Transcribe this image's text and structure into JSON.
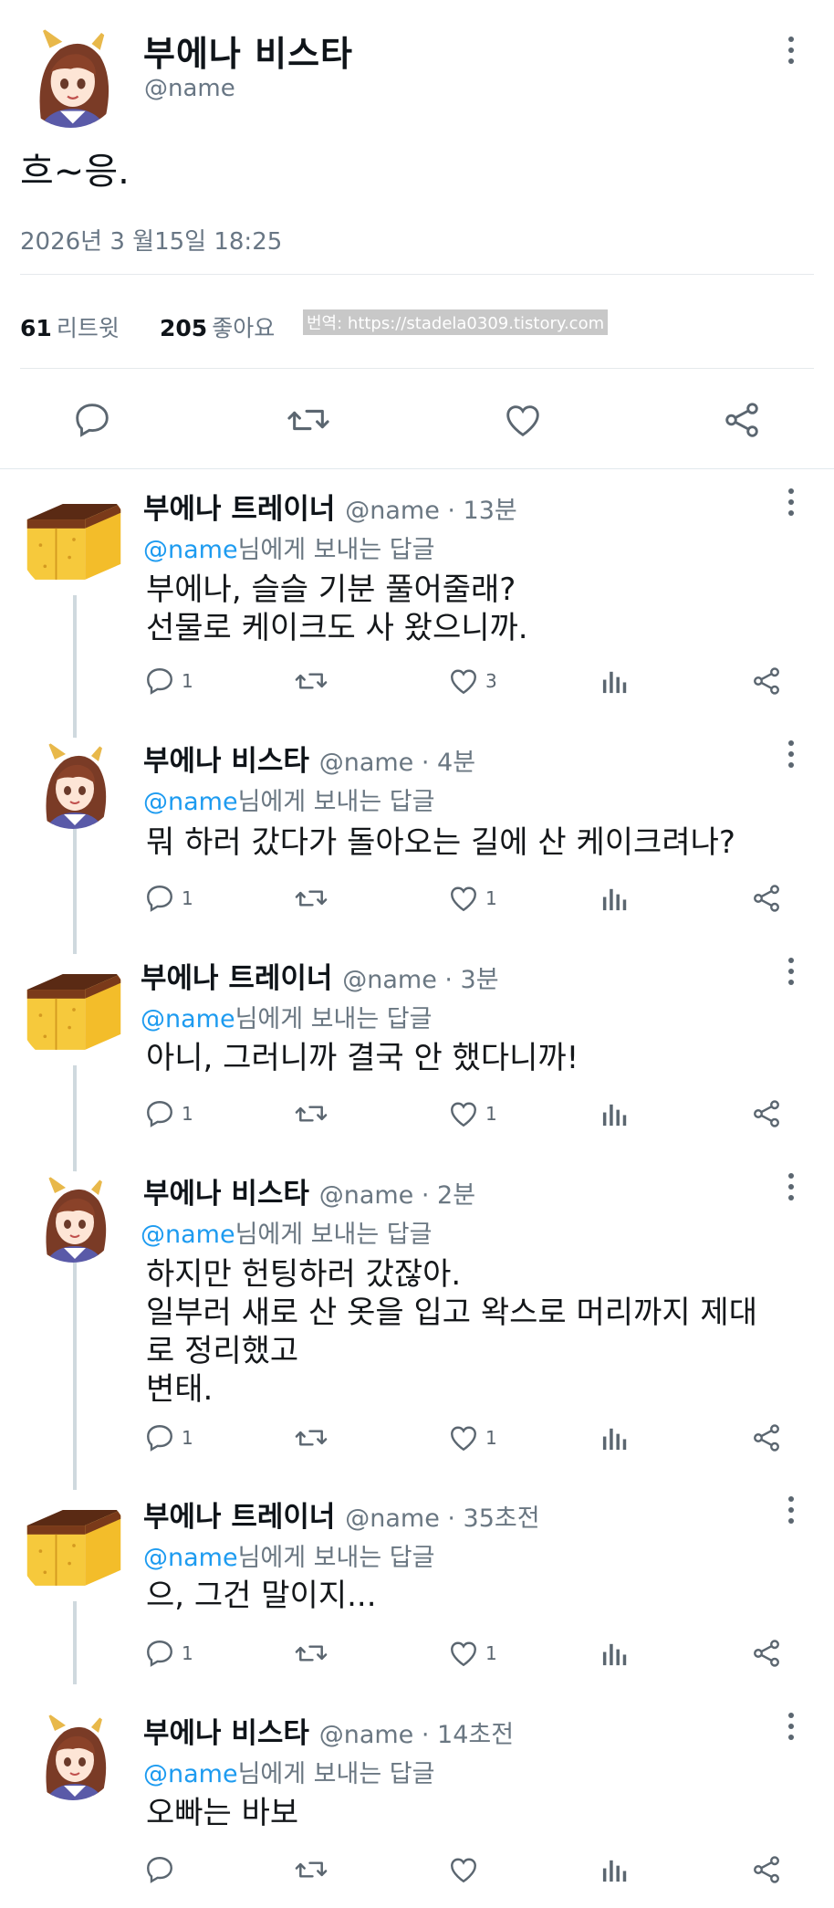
{
  "main_tweet": {
    "display_name": "부에나 비스타",
    "handle": "@name",
    "text": "흐~응.",
    "timestamp": "2026년 3 월15일  18:25",
    "retweets": {
      "count": "61",
      "label": "리트윗"
    },
    "likes": {
      "count": "205",
      "label": "좋아요"
    },
    "watermark": "번역: https://stadela0309.tistory.com",
    "actions": [
      "reply-icon",
      "retweet-icon",
      "heart-icon",
      "share-icon"
    ]
  },
  "replies": [
    {
      "author": "부에나 트레이너",
      "meta": "@name · 13분",
      "reply_to_handle": "@name",
      "reply_to_suffix": "님에게 보내는 답글",
      "text": "부에나, 슬슬 기분 풀어줄래?\n선물로 케이크도 사 왔으니까.",
      "reply_count": "1",
      "like_count": "3"
    },
    {
      "author": "부에나 비스타",
      "meta": "@name · 4분",
      "reply_to_handle": "@name",
      "reply_to_suffix": "님에게 보내는 답글",
      "text": "뭐 하러 갔다가 돌아오는 길에 산 케이크려나?",
      "reply_count": "1",
      "like_count": "1"
    },
    {
      "author": "부에나 트레이너",
      "meta": "@name · 3분",
      "reply_to_handle": "@name",
      "reply_to_suffix": "님에게 보내는 답글",
      "text": "아니, 그러니까 결국 안 했다니까!",
      "reply_count": "1",
      "like_count": "1"
    },
    {
      "author": "부에나 비스타",
      "meta": "@name · 2분",
      "reply_to_handle": "@name",
      "reply_to_suffix": "님에게 보내는 답글",
      "text": "하지만 헌팅하러 갔잖아.\n일부러 새로 산 옷을 입고 왁스로 머리까지 제대\n로 정리했고\n변태.",
      "reply_count": "1",
      "like_count": "1"
    },
    {
      "author": "부에나 트레이너",
      "meta": "@name · 35초전",
      "reply_to_handle": "@name",
      "reply_to_suffix": "님에게 보내는 답글",
      "text": "으, 그건 말이지...",
      "reply_count": "1",
      "like_count": "1"
    },
    {
      "author": "부에나 비스타",
      "meta": "@name · 14초전",
      "reply_to_handle": "@name",
      "reply_to_suffix": "님에게 보내는 답글",
      "text": "오빠는 바보",
      "reply_count": "",
      "like_count": ""
    }
  ],
  "colors": {
    "link": "#1d9bf0",
    "muted": "#687684",
    "divider": "#e5e9ec",
    "icon": "#5b6670"
  }
}
